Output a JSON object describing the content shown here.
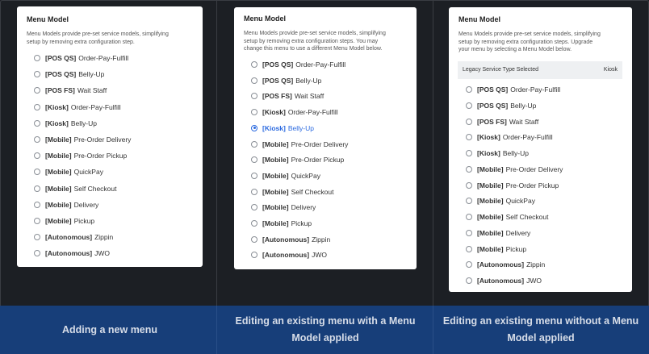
{
  "panels": [
    {
      "title": "Menu Model",
      "description": [
        "Menu Models provide pre-set service models, simplifying",
        "setup by removing extra configuration step."
      ],
      "options": [
        {
          "prefix": "[POS QS]",
          "label": "Order-Pay-Fulfill"
        },
        {
          "prefix": "[POS QS]",
          "label": "Belly-Up"
        },
        {
          "prefix": "[POS FS]",
          "label": "Wait Staff"
        },
        {
          "prefix": "[Kiosk]",
          "label": "Order-Pay-Fulfill"
        },
        {
          "prefix": "[Kiosk]",
          "label": "Belly-Up"
        },
        {
          "prefix": "[Mobile]",
          "label": "Pre-Order Delivery"
        },
        {
          "prefix": "[Mobile]",
          "label": "Pre-Order Pickup"
        },
        {
          "prefix": "[Mobile]",
          "label": "QuickPay"
        },
        {
          "prefix": "[Mobile]",
          "label": "Self Checkout"
        },
        {
          "prefix": "[Mobile]",
          "label": "Delivery"
        },
        {
          "prefix": "[Mobile]",
          "label": "Pickup"
        },
        {
          "prefix": "[Autonomous]",
          "label": "Zippin"
        },
        {
          "prefix": "[Autonomous]",
          "label": "JWO"
        }
      ],
      "selected_index": -1,
      "caption": "Adding a new menu"
    },
    {
      "title": "Menu Model",
      "description": [
        "Menu Models provide pre-set service models, simplifying",
        "setup by removing extra configuration steps. You may",
        "change this menu to use a different Menu Model below."
      ],
      "options": [
        {
          "prefix": "[POS QS]",
          "label": "Order-Pay-Fulfill"
        },
        {
          "prefix": "[POS QS]",
          "label": "Belly-Up"
        },
        {
          "prefix": "[POS FS]",
          "label": "Wait Staff"
        },
        {
          "prefix": "[Kiosk]",
          "label": "Order-Pay-Fulfill"
        },
        {
          "prefix": "[Kiosk]",
          "label": "Belly-Up"
        },
        {
          "prefix": "[Mobile]",
          "label": "Pre-Order Delivery"
        },
        {
          "prefix": "[Mobile]",
          "label": "Pre-Order Pickup"
        },
        {
          "prefix": "[Mobile]",
          "label": "QuickPay"
        },
        {
          "prefix": "[Mobile]",
          "label": "Self Checkout"
        },
        {
          "prefix": "[Mobile]",
          "label": "Delivery"
        },
        {
          "prefix": "[Mobile]",
          "label": "Pickup"
        },
        {
          "prefix": "[Autonomous]",
          "label": "Zippin"
        },
        {
          "prefix": "[Autonomous]",
          "label": "JWO"
        }
      ],
      "selected_index": 4,
      "caption": "Editing an existing menu with a Menu Model applied"
    },
    {
      "title": "Menu Model",
      "description": [
        "Menu Models provide pre-set service models, simplifying",
        "setup by removing extra configuration steps. Upgrade",
        "your menu by selecting a Menu Model below."
      ],
      "legacy": {
        "label": "Legacy Service Type Selected",
        "value": "Kiosk"
      },
      "options": [
        {
          "prefix": "[POS QS]",
          "label": "Order-Pay-Fulfill"
        },
        {
          "prefix": "[POS QS]",
          "label": "Belly-Up"
        },
        {
          "prefix": "[POS FS]",
          "label": "Wait Staff"
        },
        {
          "prefix": "[Kiosk]",
          "label": "Order-Pay-Fulfill"
        },
        {
          "prefix": "[Kiosk]",
          "label": "Belly-Up"
        },
        {
          "prefix": "[Mobile]",
          "label": "Pre-Order Delivery"
        },
        {
          "prefix": "[Mobile]",
          "label": "Pre-Order Pickup"
        },
        {
          "prefix": "[Mobile]",
          "label": "QuickPay"
        },
        {
          "prefix": "[Mobile]",
          "label": "Self Checkout"
        },
        {
          "prefix": "[Mobile]",
          "label": "Delivery"
        },
        {
          "prefix": "[Mobile]",
          "label": "Pickup"
        },
        {
          "prefix": "[Autonomous]",
          "label": "Zippin"
        },
        {
          "prefix": "[Autonomous]",
          "label": "JWO"
        }
      ],
      "selected_index": -1,
      "caption": "Editing an existing menu without a Menu Model applied"
    }
  ],
  "colors": {
    "background": "#1c1f24",
    "caption_band": "#173e79",
    "selected": "#2b6ae0"
  }
}
